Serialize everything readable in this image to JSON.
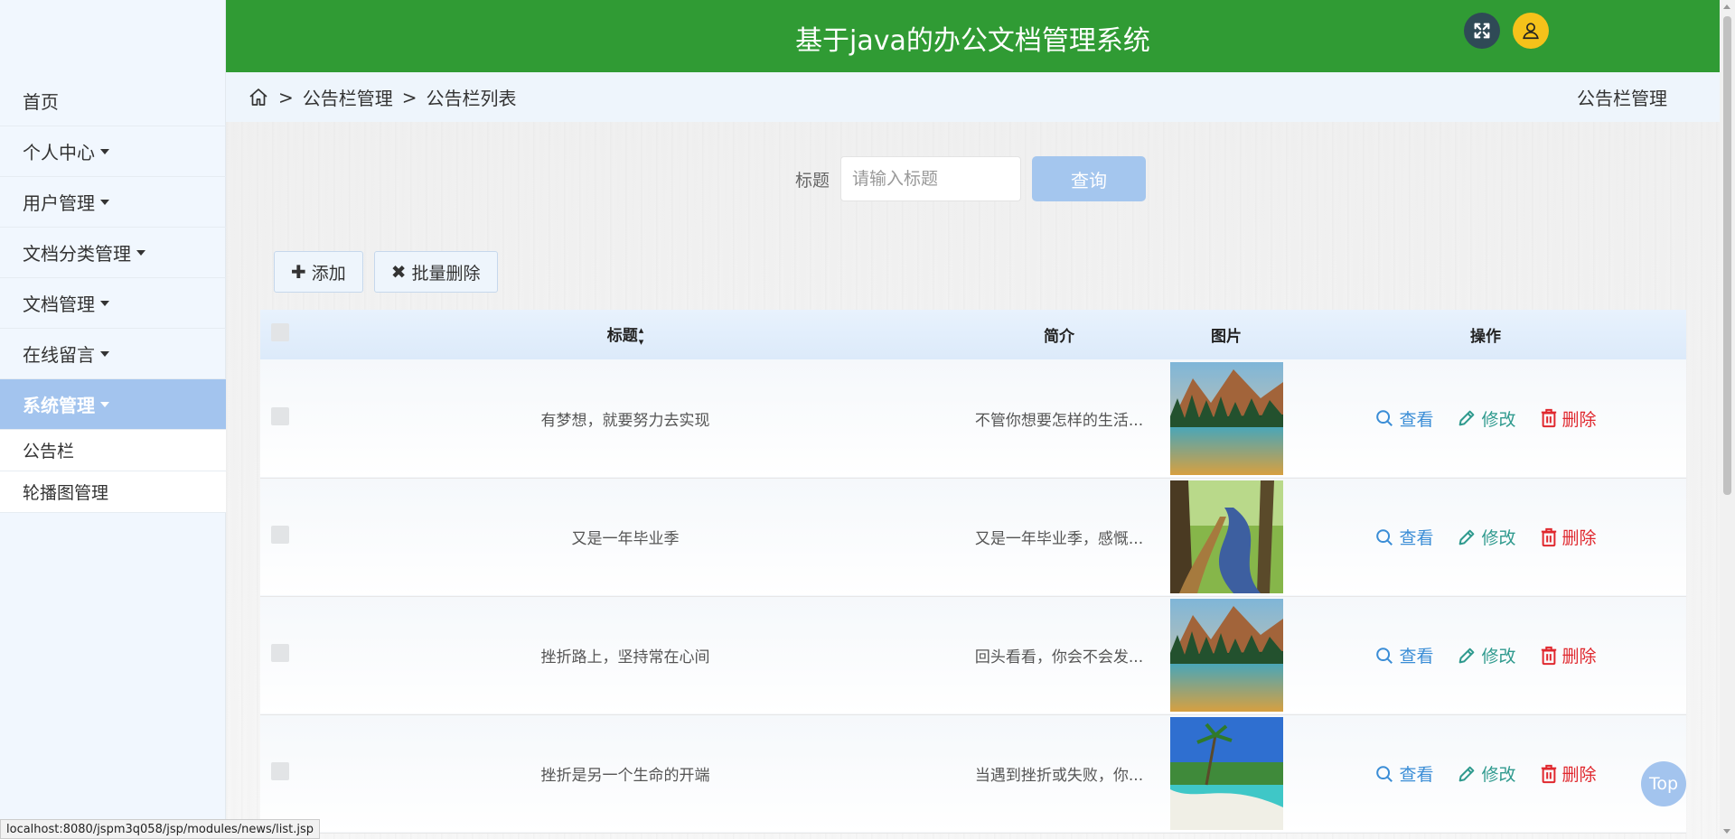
{
  "header": {
    "title": "基于java的办公文档管理系统"
  },
  "sidebar": {
    "items": [
      {
        "label": "首页",
        "has_caret": false
      },
      {
        "label": "个人中心",
        "has_caret": true
      },
      {
        "label": "用户管理",
        "has_caret": true
      },
      {
        "label": "文档分类管理",
        "has_caret": true
      },
      {
        "label": "文档管理",
        "has_caret": true
      },
      {
        "label": "在线留言",
        "has_caret": true
      },
      {
        "label": "系统管理",
        "has_caret": true,
        "active": true
      }
    ],
    "subitems": [
      {
        "label": "公告栏"
      },
      {
        "label": "轮播图管理"
      }
    ]
  },
  "breadcrumb": {
    "sep": ">",
    "items": [
      "公告栏管理",
      "公告栏列表"
    ],
    "right": "公告栏管理"
  },
  "search": {
    "label": "标题",
    "placeholder": "请输入标题",
    "button": "查询"
  },
  "toolbar": {
    "add": "添加",
    "batch_delete": "批量删除"
  },
  "table": {
    "headers": {
      "title": "标题",
      "intro": "简介",
      "image": "图片",
      "ops": "操作"
    },
    "ops": {
      "view": "查看",
      "edit": "修改",
      "delete": "删除"
    },
    "rows": [
      {
        "title": "有梦想，就要努力去实现",
        "intro": "不管你想要怎样的生活...",
        "image": "mountain-lake"
      },
      {
        "title": "又是一年毕业季",
        "intro": "又是一年毕业季，感慨...",
        "image": "forest-river"
      },
      {
        "title": "挫折路上，坚持常在心间",
        "intro": "回头看看，你会不会发...",
        "image": "mountain-lake"
      },
      {
        "title": "挫折是另一个生命的开端",
        "intro": "当遇到挫折或失败，你...",
        "image": "tropical-beach"
      }
    ]
  },
  "top_button": "Top",
  "status_url": "localhost:8080/jspm3q058/jsp/modules/news/list.jsp",
  "colors": {
    "header": "#309b34",
    "sidebar_active": "#a3c4ee",
    "view": "#3a8dd6",
    "edit": "#2f9a8e",
    "delete": "#e0282e"
  }
}
